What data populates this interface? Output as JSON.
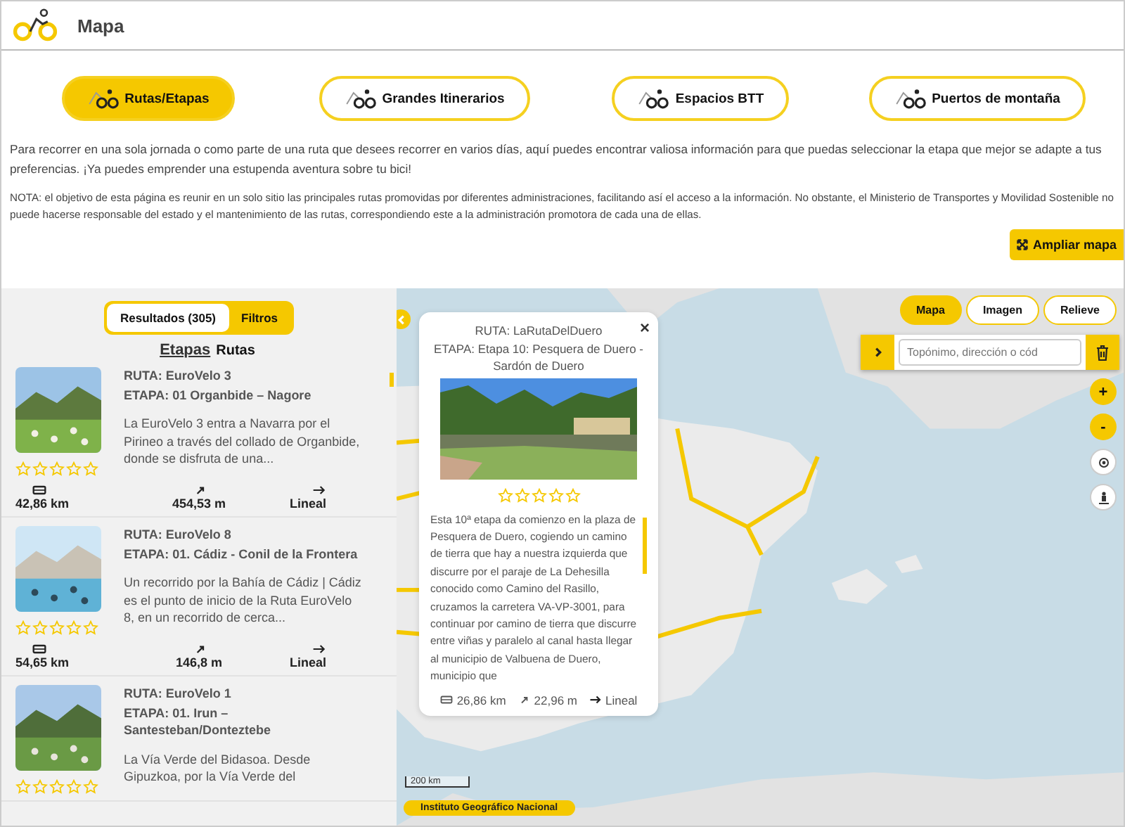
{
  "header": {
    "title": "Mapa"
  },
  "tabs": [
    {
      "label": "Rutas/Etapas",
      "selected": true
    },
    {
      "label": "Grandes Itinerarios",
      "selected": false
    },
    {
      "label": "Espacios BTT",
      "selected": false
    },
    {
      "label": "Puertos de montaña",
      "selected": false
    }
  ],
  "intro": "Para recorrer en una sola jornada o como parte de una ruta que desees recorrer en varios días, aquí puedes encontrar valiosa información para que puedas seleccionar la etapa que mejor se adapte a tus preferencias. ¡Ya puedes emprender una estupenda aventura sobre tu bici!",
  "note": "NOTA: el objetivo de esta página es reunir en un solo sitio las principales rutas promovidas por diferentes administraciones, facilitando así el acceso a la información. No obstante, el Ministerio de Transportes y Movilidad Sostenible no puede hacerse responsable del estado y el mantenimiento de las rutas, correspondiendo este a la administración promotora de cada una de ellas.",
  "expand_button": "Ampliar mapa",
  "results": {
    "segments": [
      {
        "label": "Resultados (305)",
        "selected": true
      },
      {
        "label": "Filtros",
        "selected": false
      }
    ],
    "list_tabs": [
      {
        "label": "Etapas",
        "selected": true
      },
      {
        "label": "Rutas",
        "selected": false
      }
    ],
    "items": [
      {
        "ruta": "RUTA: EuroVelo 3",
        "etapa": "ETAPA: 01 Organbide – Nagore",
        "description": "La EuroVelo 3 entra a Navarra por el Pirineo a través del collado de Organbide, donde se disfruta de una...",
        "stars": 0,
        "distance": "42,86 km",
        "elevation": "454,53 m",
        "type": "Lineal"
      },
      {
        "ruta": "RUTA: EuroVelo 8",
        "etapa": "ETAPA: 01. Cádiz - Conil de la Frontera",
        "description": "Un recorrido por la Bahía de Cádiz | Cádiz es el punto de inicio de la Ruta EuroVelo 8, en un recorrido de cerca...",
        "stars": 0,
        "distance": "54,65 km",
        "elevation": "146,8 m",
        "type": "Lineal"
      },
      {
        "ruta": "RUTA: EuroVelo 1",
        "etapa": "ETAPA: 01. Irun – Santesteban/Donteztebe",
        "description": "La Vía Verde del Bidasoa. Desde Gipuzkoa, por la Vía Verde del",
        "stars": 0
      }
    ]
  },
  "map": {
    "layers": [
      {
        "label": "Mapa",
        "selected": true
      },
      {
        "label": "Imagen",
        "selected": false
      },
      {
        "label": "Relieve",
        "selected": false
      }
    ],
    "search": {
      "placeholder": "Topónimo, dirección o cód"
    },
    "zoom_in": "+",
    "zoom_out": "-",
    "scale": "200 km",
    "attribution": "Instituto Geográfico Nacional"
  },
  "popup": {
    "close": "×",
    "ruta": "RUTA: LaRutaDelDuero",
    "etapa": "ETAPA: Etapa 10: Pesquera de Duero - Sardón de Duero",
    "stars": 0,
    "description": "Esta 10ª etapa da comienzo en la plaza de Pesquera de Duero, cogiendo un camino de tierra que hay a nuestra izquierda que discurre por el paraje de La Dehesilla conocido como Camino del Rasillo, cruzamos la carretera VA-VP-3001, para continuar por camino de tierra que discurre entre viñas y paralelo al canal hasta llegar al municipio de Valbuena de Duero, municipio que",
    "distance": "26,86 km",
    "elevation": "22,96 m",
    "type": "Lineal"
  }
}
